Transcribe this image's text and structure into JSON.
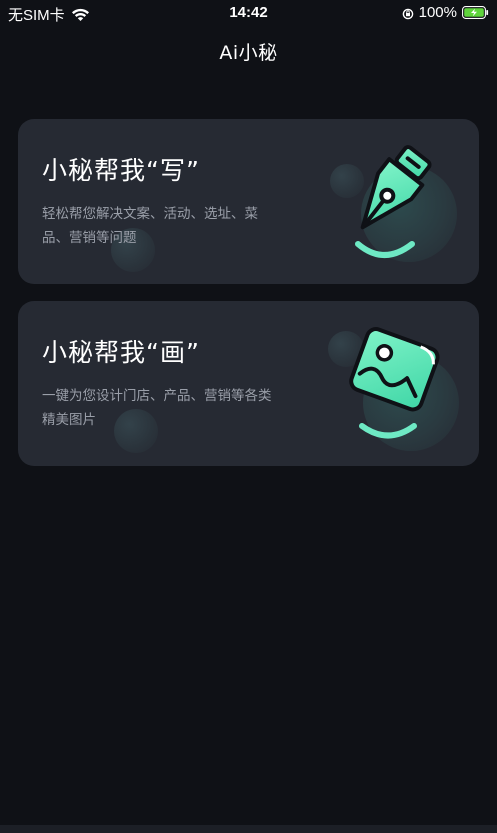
{
  "status_bar": {
    "carrier": "无SIM卡",
    "time": "14:42",
    "battery": "100%"
  },
  "header": {
    "title": "Ai小秘"
  },
  "cards": [
    {
      "title": "小秘帮我“写”",
      "description": "轻松帮您解决文案、活动、选址、菜品、营销等问题",
      "icon": "pen-nib-icon"
    },
    {
      "title": "小秘帮我“画”",
      "description": "一键为您设计门店、产品、营销等各类精美图片",
      "icon": "image-picture-icon"
    }
  ],
  "colors": {
    "background": "#0f1116",
    "card": "#262a33",
    "accent": "#5ee6b6",
    "muted_text": "#9a9fa9"
  }
}
